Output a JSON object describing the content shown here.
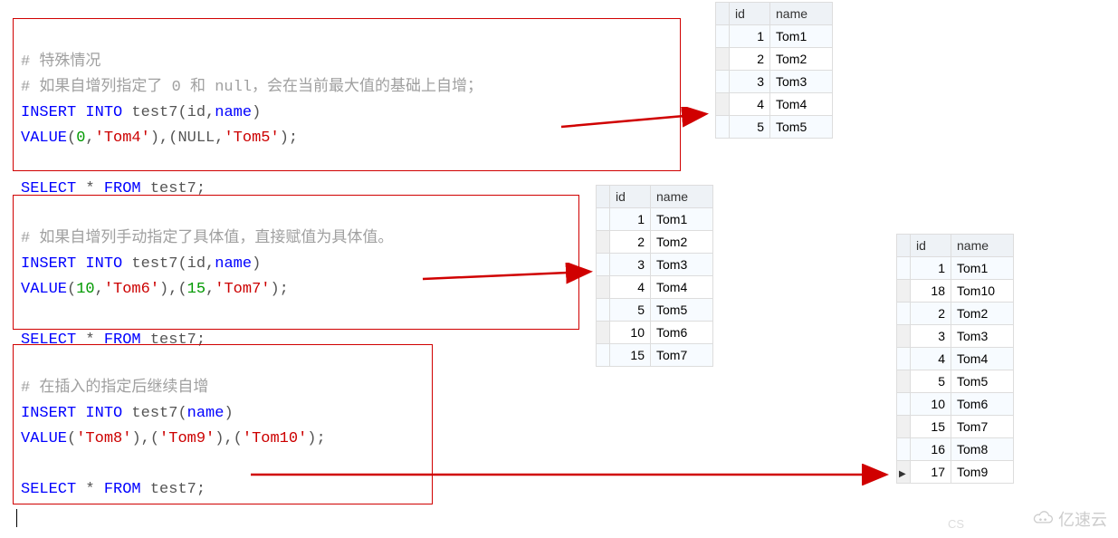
{
  "code_blocks": {
    "b1": {
      "l1_hash": "#",
      "l1_text": " 特殊情况",
      "l2_hash": "#",
      "l2_text": " 如果自增列指定了 0 和 null，会在当前最大值的基础上自增；",
      "l3_insert": "INSERT",
      "l3_into": " INTO",
      "l3_rest": " test7(id,",
      "l3_name": "name",
      "l3_close": ")",
      "l4_value": "VALUE",
      "l4_p1": "(",
      "l4_v1": "0",
      "l4_c1": ",",
      "l4_s1": "'Tom4'",
      "l4_p2": "),(",
      "l4_null": "NULL",
      "l4_c2": ",",
      "l4_s2": "'Tom5'",
      "l4_p3": ");",
      "l6_select": "SELECT",
      "l6_star": " * ",
      "l6_from": "FROM",
      "l6_rest": " test7;"
    },
    "b2": {
      "l1_hash": "#",
      "l1_text": " 如果自增列手动指定了具体值，直接赋值为具体值。",
      "l2_insert": "INSERT",
      "l2_into": " INTO",
      "l2_rest": " test7(id,",
      "l2_name": "name",
      "l2_close": ")",
      "l3_value": "VALUE",
      "l3_p1": "(",
      "l3_v1": "10",
      "l3_c1": ",",
      "l3_s1": "'Tom6'",
      "l3_p2": "),(",
      "l3_v2": "15",
      "l3_c2": ",",
      "l3_s2": "'Tom7'",
      "l3_p3": ");",
      "l5_select": "SELECT",
      "l5_star": " * ",
      "l5_from": "FROM",
      "l5_rest": " test7;"
    },
    "b3": {
      "l1_hash": "#",
      "l1_text": " 在插入的指定后继续自增",
      "l2_insert": "INSERT",
      "l2_into": " INTO",
      "l2_rest": " test7(",
      "l2_name": "name",
      "l2_close": ")",
      "l3_value": "VALUE",
      "l3_p1": "(",
      "l3_s1": "'Tom8'",
      "l3_p2": "),(",
      "l3_s2": "'Tom9'",
      "l3_p3": "),(",
      "l3_s3": "'Tom10'",
      "l3_p4": ");",
      "l5_select": "SELECT",
      "l5_star": " * ",
      "l5_from": "FROM",
      "l5_rest": " test7;"
    }
  },
  "tables": {
    "t1": {
      "cols": [
        "id",
        "name"
      ],
      "rows": [
        {
          "id": "1",
          "name": "Tom1"
        },
        {
          "id": "2",
          "name": "Tom2"
        },
        {
          "id": "3",
          "name": "Tom3"
        },
        {
          "id": "4",
          "name": "Tom4"
        },
        {
          "id": "5",
          "name": "Tom5"
        }
      ]
    },
    "t2": {
      "cols": [
        "id",
        "name"
      ],
      "rows": [
        {
          "id": "1",
          "name": "Tom1"
        },
        {
          "id": "2",
          "name": "Tom2"
        },
        {
          "id": "3",
          "name": "Tom3"
        },
        {
          "id": "4",
          "name": "Tom4"
        },
        {
          "id": "5",
          "name": "Tom5"
        },
        {
          "id": "10",
          "name": "Tom6"
        },
        {
          "id": "15",
          "name": "Tom7"
        }
      ]
    },
    "t3": {
      "cols": [
        "id",
        "name"
      ],
      "rows": [
        {
          "id": "1",
          "name": "Tom1"
        },
        {
          "id": "18",
          "name": "Tom10"
        },
        {
          "id": "2",
          "name": "Tom2"
        },
        {
          "id": "3",
          "name": "Tom3"
        },
        {
          "id": "4",
          "name": "Tom4"
        },
        {
          "id": "5",
          "name": "Tom5"
        },
        {
          "id": "10",
          "name": "Tom6"
        },
        {
          "id": "15",
          "name": "Tom7"
        },
        {
          "id": "16",
          "name": "Tom8"
        },
        {
          "id": "17",
          "name": "Tom9"
        }
      ],
      "current_row_index": 9
    }
  },
  "watermark": {
    "text": "亿速云",
    "csdn": "CS"
  }
}
